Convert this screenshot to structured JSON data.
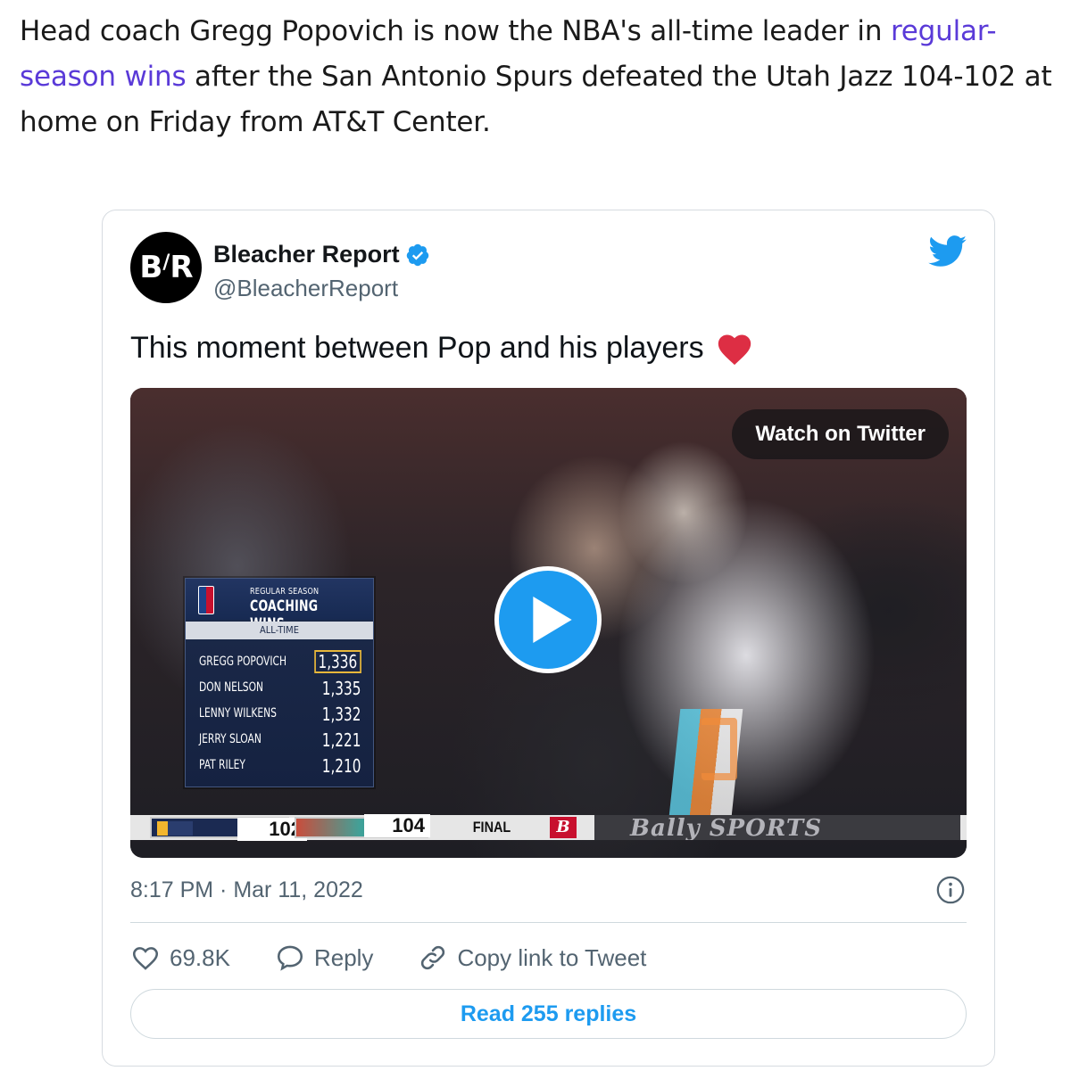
{
  "article": {
    "text_before": "Head coach Gregg Popovich is now the NBA's all-time leader in ",
    "link_text": "regular-season wins",
    "text_after": " after the San Antonio Spurs defeated the Utah Jazz 104-102 at home on Friday from AT&T Center."
  },
  "tweet": {
    "avatar_text_left": "B",
    "avatar_text_right": "R",
    "author_name": "Bleacher Report",
    "author_handle": "@BleacherReport",
    "text": "This moment between Pop and his players",
    "text_emoji": "red-heart-icon",
    "timestamp": "8:17 PM · Mar 11, 2022",
    "likes": "69.8K",
    "reply_label": "Reply",
    "copy_link_label": "Copy link to Tweet",
    "read_replies_label": "Read 255 replies"
  },
  "media": {
    "watch_label": "Watch on Twitter",
    "stats": {
      "subtitle": "REGULAR SEASON",
      "title": "COACHING WINS",
      "period": "ALL-TIME",
      "rows": [
        {
          "name": "GREGG POPOVICH",
          "wins": "1,336"
        },
        {
          "name": "DON NELSON",
          "wins": "1,335"
        },
        {
          "name": "LENNY WILKENS",
          "wins": "1,332"
        },
        {
          "name": "JERRY SLOAN",
          "wins": "1,221"
        },
        {
          "name": "PAT RILEY",
          "wins": "1,210"
        }
      ]
    },
    "scoreboard": {
      "team1_score": "102",
      "team2_score": "104",
      "status": "FINAL",
      "network_logo": "B",
      "network_wordmark": "Bally SPORTS"
    }
  },
  "colors": {
    "link": "#5a3ad8",
    "twitter_blue": "#1d9bf0",
    "muted": "#536471",
    "heart": "#e0245e"
  }
}
